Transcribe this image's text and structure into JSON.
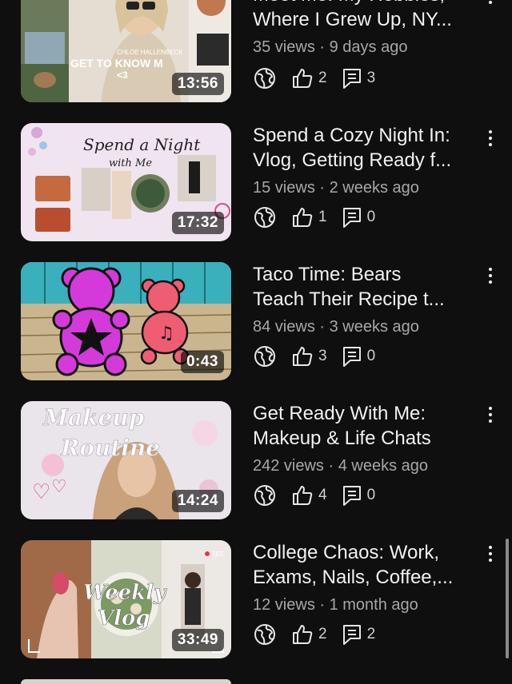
{
  "videos": [
    {
      "title_line1": "Meet Me: My Hobbies,",
      "title_line2": "Where I Grew Up, NY...",
      "views": "35 views",
      "age": "9 days ago",
      "duration": "13:56",
      "likes": "2",
      "comments": "3",
      "thumb_text": "GET TO KNOW M",
      "thumb_text2": "<3",
      "thumb_small": "CHLOE HALLENBECK"
    },
    {
      "title_line1": "Spend a Cozy Night In:",
      "title_line2": "Vlog, Getting Ready f...",
      "views": "15 views",
      "age": "2 weeks ago",
      "duration": "17:32",
      "likes": "1",
      "comments": "0",
      "thumb_text": "Spend a Night",
      "thumb_text2": "with Me"
    },
    {
      "title_line1": "Taco Time: Bears",
      "title_line2": "Teach Their Recipe t...",
      "views": "84 views",
      "age": "3 weeks ago",
      "duration": "0:43",
      "likes": "3",
      "comments": "0"
    },
    {
      "title_line1": "Get Ready With Me:",
      "title_line2": "Makeup & Life Chats",
      "views": "242 views",
      "age": "4 weeks ago",
      "duration": "14:24",
      "likes": "4",
      "comments": "0",
      "thumb_text": "Makeup",
      "thumb_text2": "Routine"
    },
    {
      "title_line1": "College Chaos: Work,",
      "title_line2": "Exams, Nails, Coffee,...",
      "views": "12 views",
      "age": "1 month ago",
      "duration": "33:49",
      "likes": "2",
      "comments": "2",
      "thumb_text": "Weekly",
      "thumb_text2": "Vlog",
      "thumb_small": "REC"
    }
  ],
  "separator": "·",
  "icons": {
    "visibility": "globe-icon",
    "likes": "thumbs-up-icon",
    "comments": "comment-icon",
    "menu": "more-vertical-icon"
  }
}
